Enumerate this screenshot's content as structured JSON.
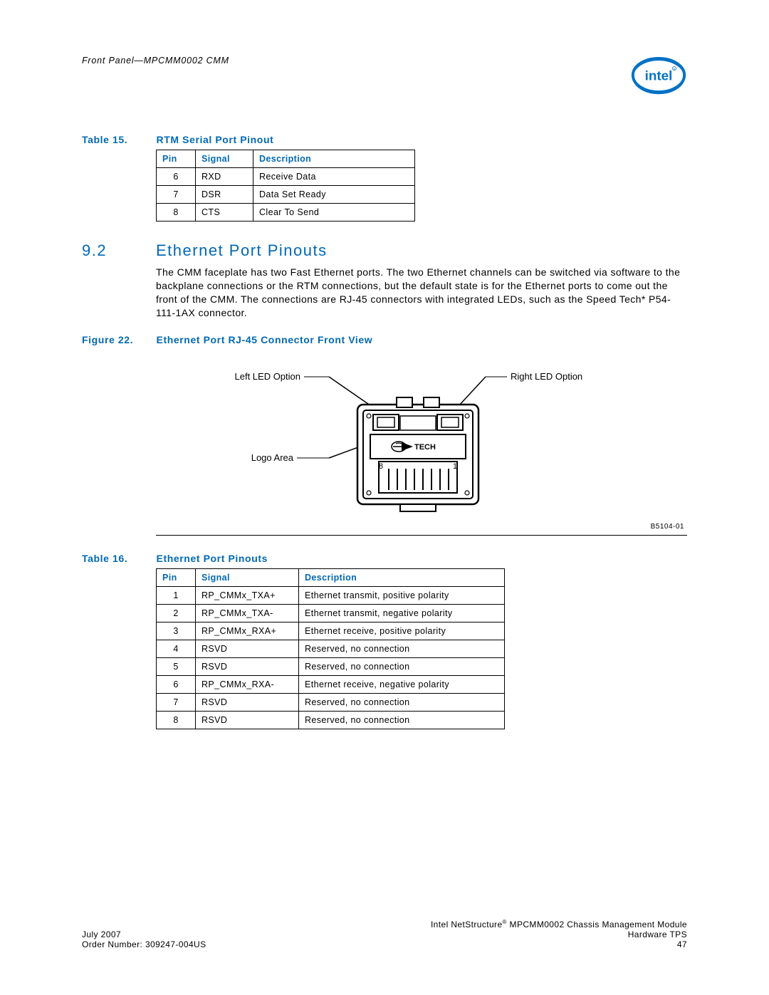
{
  "header": {
    "running_head": "Front Panel—MPCMM0002 CMM"
  },
  "table15": {
    "label": "Table 15.",
    "title": "RTM Serial Port Pinout",
    "headers": {
      "pin": "Pin",
      "signal": "Signal",
      "desc": "Description"
    },
    "rows": [
      {
        "pin": "6",
        "signal": "RXD",
        "desc": "Receive Data"
      },
      {
        "pin": "7",
        "signal": "DSR",
        "desc": "Data Set Ready"
      },
      {
        "pin": "8",
        "signal": "CTS",
        "desc": "Clear To Send"
      }
    ]
  },
  "section": {
    "number": "9.2",
    "title": "Ethernet Port Pinouts",
    "body": "The CMM faceplate has two Fast Ethernet ports. The two Ethernet channels can be switched via software to the backplane connections or the RTM connections, but the default state is for the Ethernet ports to come out the front of the CMM. The connections are RJ-45 connectors with integrated LEDs, such as the Speed Tech* P54-111-1AX connector."
  },
  "figure22": {
    "label": "Figure 22.",
    "title": "Ethernet Port RJ-45 Connector Front View",
    "labels": {
      "left_led": "Left LED Option",
      "right_led": "Right LED Option",
      "logo": "Logo Area",
      "tech": "TECH",
      "pin8": "8",
      "pin1": "1"
    },
    "code": "B5104-01"
  },
  "table16": {
    "label": "Table 16.",
    "title": "Ethernet Port Pinouts",
    "headers": {
      "pin": "Pin",
      "signal": "Signal",
      "desc": "Description"
    },
    "rows": [
      {
        "pin": "1",
        "signal": "RP_CMMx_TXA+",
        "desc": "Ethernet transmit, positive polarity"
      },
      {
        "pin": "2",
        "signal": "RP_CMMx_TXA-",
        "desc": "Ethernet transmit, negative polarity"
      },
      {
        "pin": "3",
        "signal": "RP_CMMx_RXA+",
        "desc": "Ethernet receive, positive polarity"
      },
      {
        "pin": "4",
        "signal": "RSVD",
        "desc": "Reserved, no connection"
      },
      {
        "pin": "5",
        "signal": "RSVD",
        "desc": "Reserved, no connection"
      },
      {
        "pin": "6",
        "signal": "RP_CMMx_RXA-",
        "desc": "Ethernet receive, negative polarity"
      },
      {
        "pin": "7",
        "signal": "RSVD",
        "desc": "Reserved, no connection"
      },
      {
        "pin": "8",
        "signal": "RSVD",
        "desc": "Reserved, no connection"
      }
    ]
  },
  "footer": {
    "product": "Intel NetStructure",
    "product2": " MPCMM0002 Chassis Management Module",
    "date": "July 2007",
    "doc": "Hardware TPS",
    "order": "Order Number: 309247-004US",
    "page": "47"
  }
}
